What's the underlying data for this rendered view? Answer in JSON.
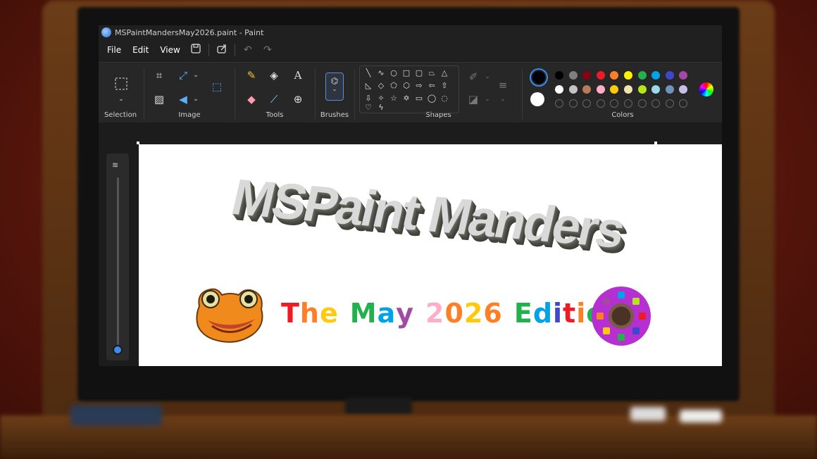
{
  "window": {
    "title": "MSPaintMandersMay2026.paint - Paint"
  },
  "menu": {
    "items": [
      "File",
      "Edit",
      "View"
    ]
  },
  "quick_access": {
    "save": "💾",
    "share": "⇪",
    "undo": "↶",
    "redo": "↷"
  },
  "ribbon": {
    "groups": {
      "selection": "Selection",
      "image": "Image",
      "tools": "Tools",
      "brushes": "Brushes",
      "shapes": "Shapes",
      "colors": "Colors"
    },
    "color_swatches_row1": [
      "#000000",
      "#7f7f7f",
      "#880015",
      "#ed1c24",
      "#ff7f27",
      "#fff200",
      "#22b14c",
      "#00a2e8",
      "#3f48cc",
      "#a349a4"
    ],
    "color_swatches_row2": [
      "#ffffff",
      "#c3c3c3",
      "#b97a57",
      "#ffaec9",
      "#ffc90e",
      "#efe4b0",
      "#b5e61d",
      "#99d9ea",
      "#7092be",
      "#c8bfe7"
    ],
    "primary_color": "#000000",
    "secondary_color": "#ffffff"
  },
  "canvas": {
    "title_text": "MSPaint Manders",
    "subtitle_words": [
      {
        "text": "The",
        "colors": [
          "#ed1c24",
          "#ff7f27",
          "#ffc90e"
        ]
      },
      {
        "text": "May",
        "colors": [
          "#22b14c",
          "#00a2e8",
          "#a349a4"
        ]
      },
      {
        "text": "2026",
        "colors": [
          "#ffaec9",
          "#ff7f27",
          "#ffc90e",
          "#ff7f27"
        ]
      },
      {
        "text": "Edition",
        "colors": [
          "#22b14c",
          "#00a2e8",
          "#3f48cc",
          "#ed1c24",
          "#ff7f27",
          "#22b14c",
          "#ffc90e"
        ]
      }
    ]
  }
}
